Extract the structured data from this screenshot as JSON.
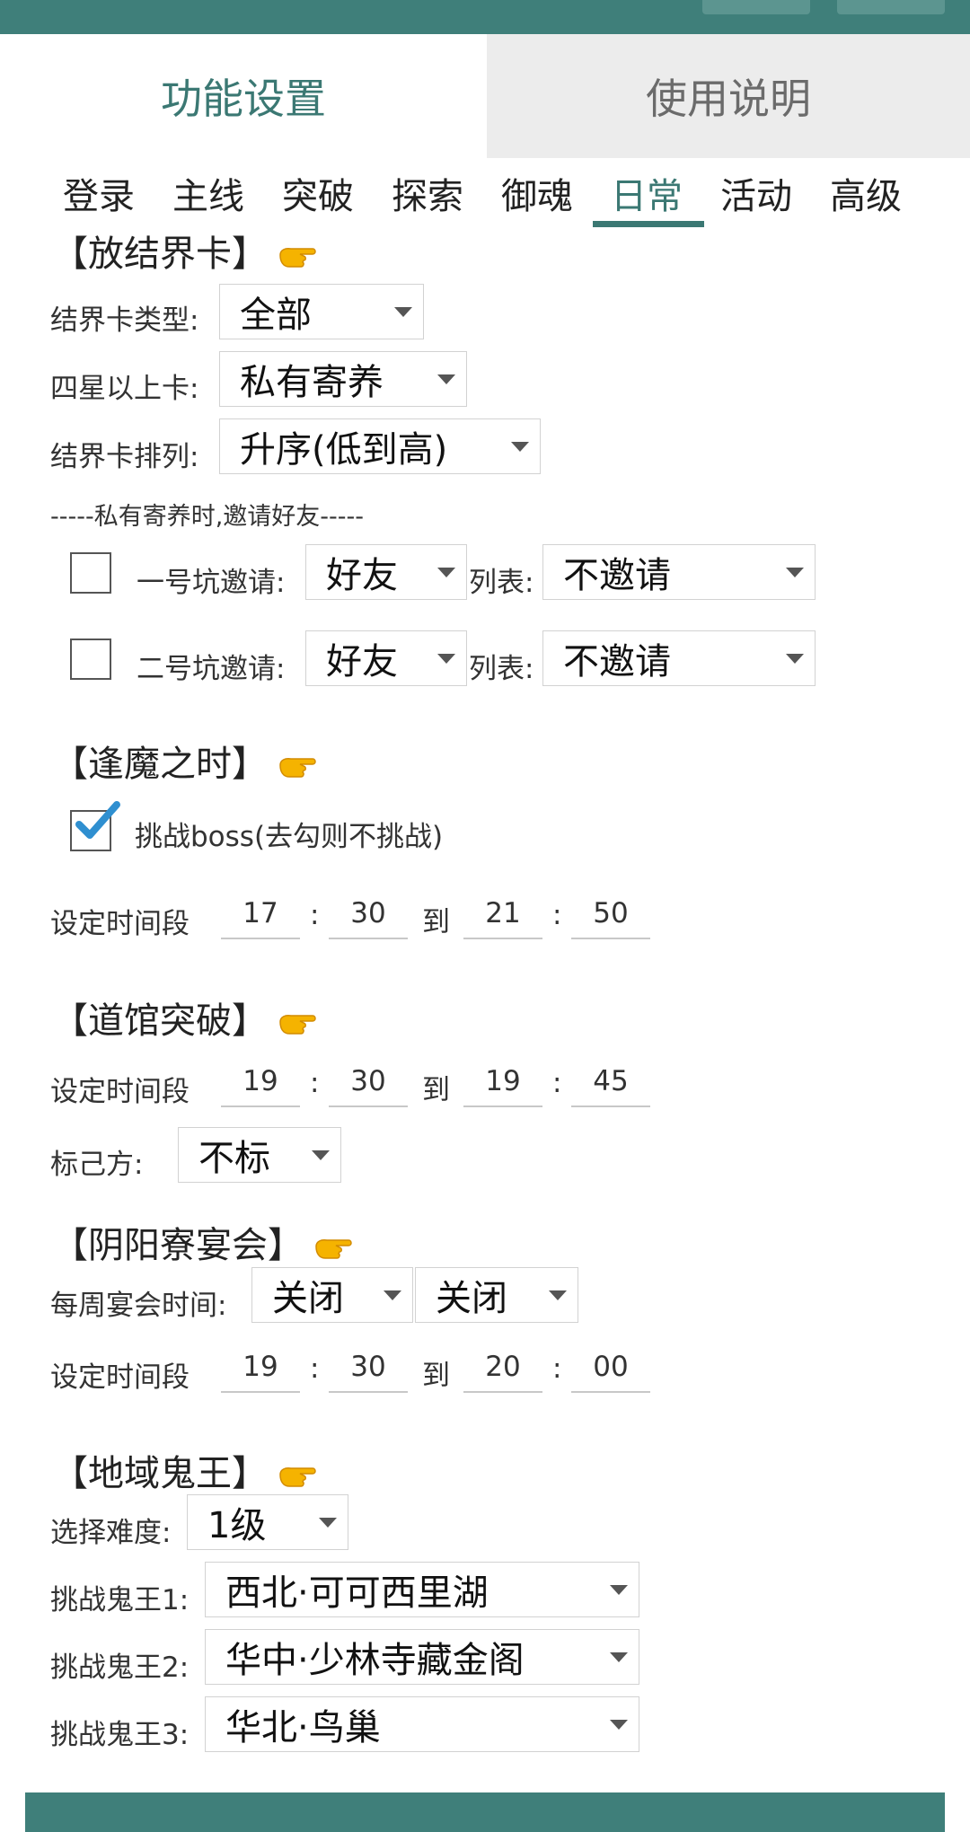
{
  "tabs": {
    "active": "功能设置",
    "inactive": "使用说明"
  },
  "subtabs": [
    "登录",
    "主线",
    "突破",
    "探索",
    "御魂",
    "日常",
    "活动",
    "高级"
  ],
  "subtab_selected": "日常",
  "sections": {
    "card": {
      "title": "【放结界卡】",
      "type_label": "结界卡类型:",
      "type_value": "全部",
      "star_label": "四星以上卡:",
      "star_value": "私有寄养",
      "order_label": "结界卡排列:",
      "order_value": "升序(低到高)",
      "note": "-----私有寄养时,邀请好友-----",
      "invite1": {
        "label": "一号坑邀请:",
        "who": "好友",
        "list_label": "列表:",
        "list_value": "不邀请",
        "checked": false
      },
      "invite2": {
        "label": "二号坑邀请:",
        "who": "好友",
        "list_label": "列表:",
        "list_value": "不邀请",
        "checked": false
      }
    },
    "boss": {
      "title": "【逢魔之时】",
      "check_label": "挑战boss(去勾则不挑战)",
      "checked": true,
      "time_label": "设定时间段",
      "h1": "17",
      "m1": "30",
      "to": "到",
      "h2": "21",
      "m2": "50"
    },
    "dojo": {
      "title": "【道馆突破】",
      "time_label": "设定时间段",
      "h1": "19",
      "m1": "30",
      "to": "到",
      "h2": "19",
      "m2": "45",
      "mark_label": "标己方:",
      "mark_value": "不标"
    },
    "feast": {
      "title": "【阴阳寮宴会】",
      "week_label": "每周宴会时间:",
      "week1": "关闭",
      "week2": "关闭",
      "time_label": "设定时间段",
      "h1": "19",
      "m1": "30",
      "to": "到",
      "h2": "20",
      "m2": "00"
    },
    "ghost": {
      "title": "【地域鬼王】",
      "diff_label": "选择难度:",
      "diff_value": "1级",
      "b1_label": "挑战鬼王1:",
      "b1_value": "西北·可可西里湖",
      "b2_label": "挑战鬼王2:",
      "b2_value": "华中·少林寺藏金阁",
      "b3_label": "挑战鬼王3:",
      "b3_value": "华北·鸟巢"
    }
  },
  "colors": {
    "accent": "#3b7873",
    "bar": "#3f7f7a",
    "tick": "#2f8fd0",
    "hand": "#f5b300"
  }
}
